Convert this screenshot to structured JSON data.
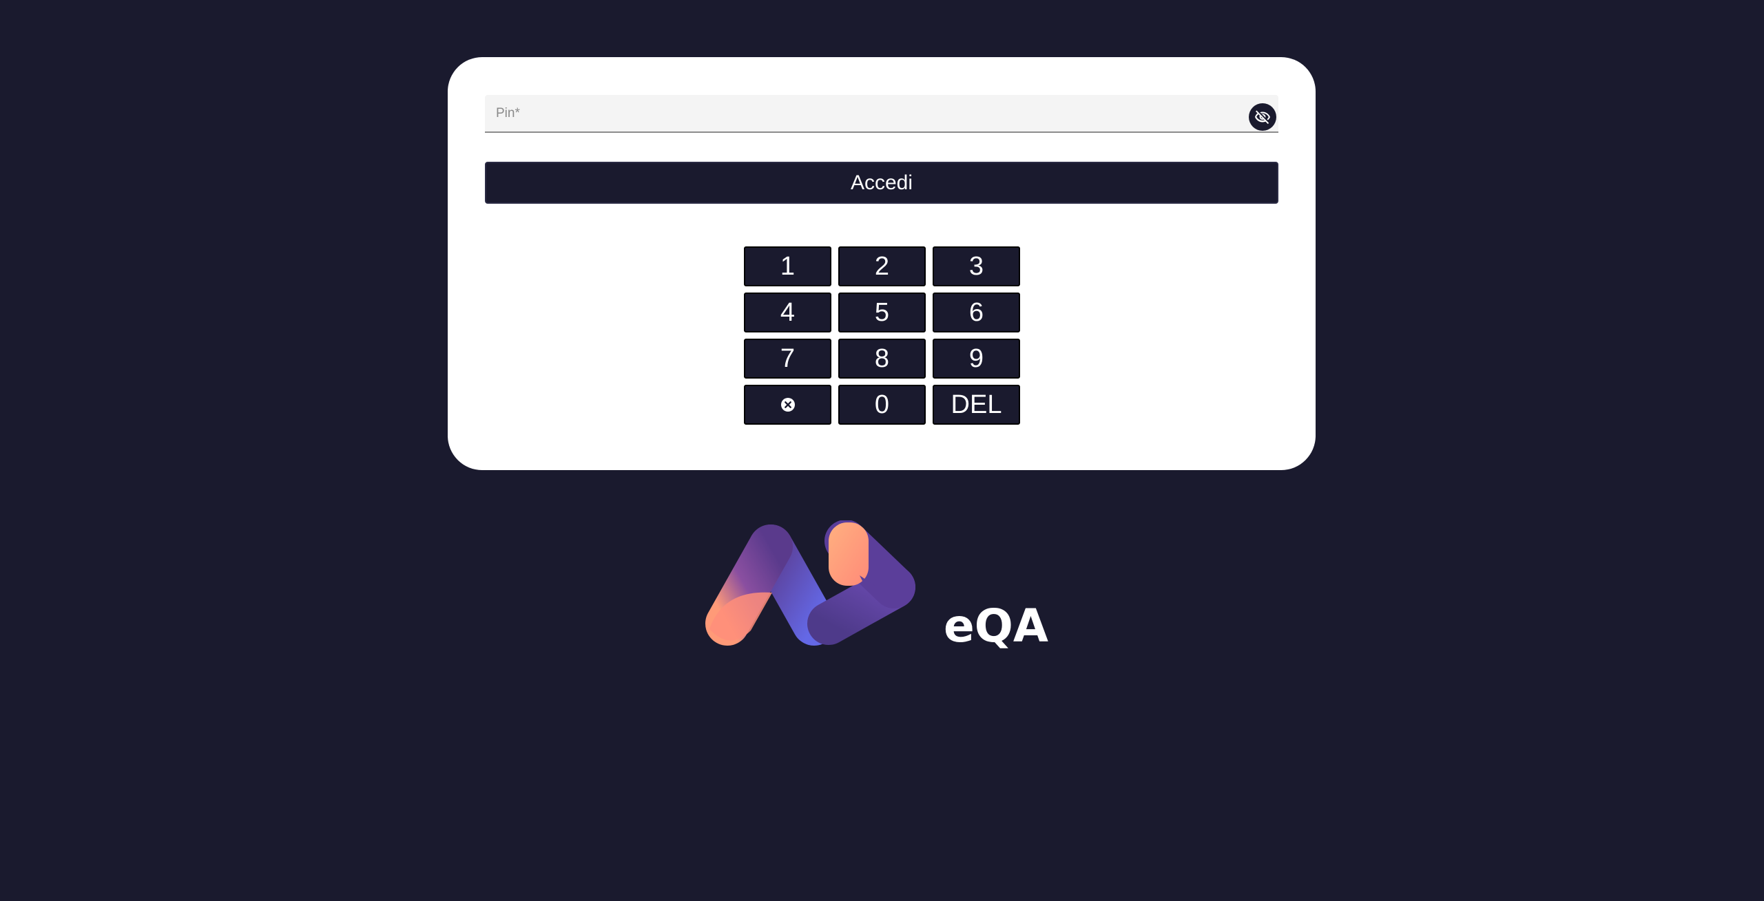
{
  "theme": {
    "background": "#1a1a2e",
    "card": "#ffffff",
    "field_background": "#f4f4f4",
    "logo_gradient_from": "#ffa07a",
    "logo_gradient_to": "#6a5acd"
  },
  "pin_field": {
    "placeholder": "Pin*",
    "value": "",
    "toggle_icon": "eye-off-icon"
  },
  "login_button": {
    "label": "Accedi"
  },
  "keypad": {
    "keys": [
      "1",
      "2",
      "3",
      "4",
      "5",
      "6",
      "7",
      "8",
      "9",
      "",
      "0",
      "DEL"
    ],
    "clear_icon": "clear-circle-icon"
  },
  "logo": {
    "text": "eQA"
  }
}
